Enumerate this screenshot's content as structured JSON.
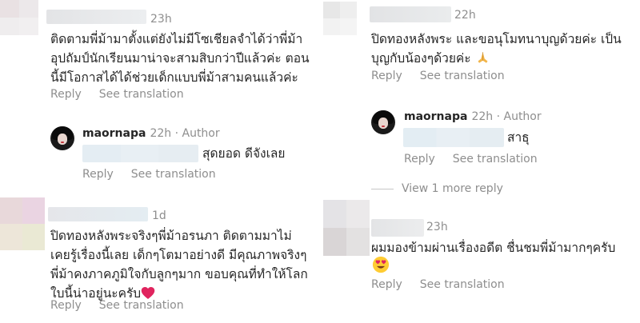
{
  "comments": [
    {
      "time": "23h",
      "text": "ติดตามพี่ม้ามาตั้งแต่ยังไม่มีโซเชียลจำได้ว่าพี่ม้า\nอุปถัมป์นักเรียนมาน่าจะสามสิบกว่าปีแล้วค่ะ ตอน\nนี้มีโอกาสได้ได้ช่วยเด็กแบบพี่ม้าสามคนแล้วค่ะ",
      "reply_label": "Reply",
      "translate_label": "See translation",
      "author_reply": {
        "username": "maornapa",
        "meta": "22h · Author",
        "text": "สุดยอด ดีจังเลย",
        "reply_label": "Reply",
        "translate_label": "See translation"
      }
    },
    {
      "time": "1d",
      "text": "ปิดทองหลังพระจริงๆพี่ม้าอรนภา ติดตามมาไม่\nเคยรู้เรื่องนี้เลย เด็กๆโตมาอย่างดี มีคุณภาพจริงๆ\nพี่ม้าคงภาคภูมิใจกับลูกๆมาก ขอบคุณที่ทำให้โลก\nใบนี้น่าอยู่นะครับ",
      "emoji": "heart",
      "reply_label": "Reply",
      "translate_label": "See translation"
    },
    {
      "time": "22h",
      "text": "ปิดทองหลังพระ และขอนุโมทนาบุญด้วยค่ะ เป็น\nบุญกับน้องๆด้วยค่ะ",
      "emoji": "praying-hands",
      "reply_label": "Reply",
      "translate_label": "See translation",
      "author_reply": {
        "username": "maornapa",
        "meta": "22h · Author",
        "text": "สาธุ",
        "reply_label": "Reply",
        "translate_label": "See translation"
      },
      "view_more_label": "View 1 more reply"
    },
    {
      "time": "23h",
      "text": "ผมมองข้ามผ่านเรื่องอดีต ชื่นชมพี่ม้ามากๆครับ",
      "emoji": "heart-eyes",
      "reply_label": "Reply",
      "translate_label": "See translation"
    }
  ],
  "colors": {
    "secondary_text": "#8e8e8e",
    "primary_text": "#262626",
    "blur_light": "#e7eef3",
    "heart": "#e0245e"
  }
}
